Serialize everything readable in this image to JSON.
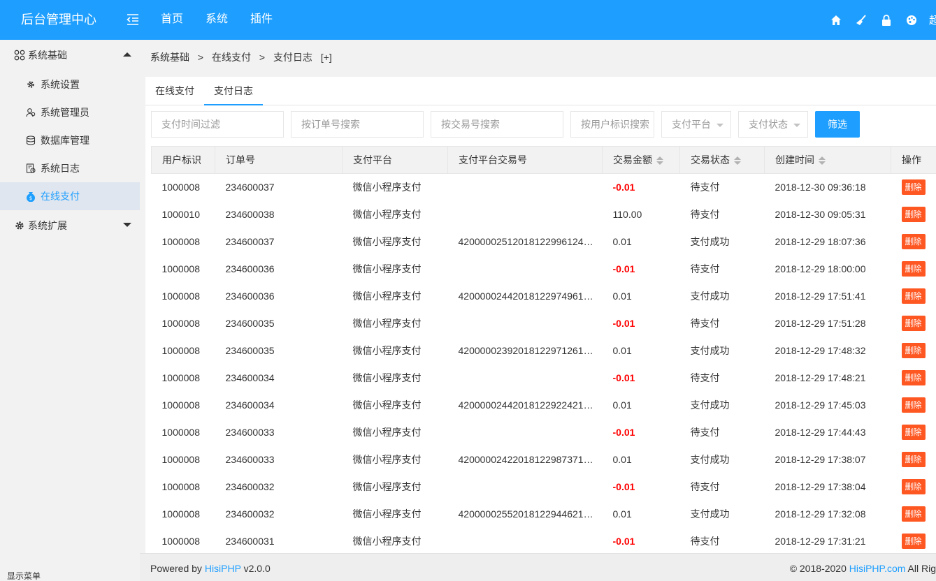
{
  "header": {
    "logo": "后台管理中心",
    "nav": [
      "首页",
      "系统",
      "插件"
    ],
    "user_partial": "超"
  },
  "sidebar": {
    "groups": [
      {
        "label": "系统基础",
        "icon": "apps-icon",
        "expanded": true,
        "items": [
          {
            "label": "系统设置",
            "icon": "gear-icon",
            "active": false
          },
          {
            "label": "系统管理员",
            "icon": "users-icon",
            "active": false
          },
          {
            "label": "数据库管理",
            "icon": "database-icon",
            "active": false
          },
          {
            "label": "系统日志",
            "icon": "log-icon",
            "active": false
          },
          {
            "label": "在线支付",
            "icon": "money-bag-icon",
            "active": true
          }
        ]
      },
      {
        "label": "系统扩展",
        "icon": "gear-icon",
        "expanded": false
      }
    ],
    "footer": "显示菜单"
  },
  "breadcrumb": [
    "系统基础",
    ">",
    "在线支付",
    ">",
    "支付日志",
    "[+]"
  ],
  "tabs": [
    {
      "label": "在线支付",
      "active": false
    },
    {
      "label": "支付日志",
      "active": true
    }
  ],
  "filters": {
    "time": "支付时间过滤",
    "order": "按订单号搜索",
    "trade": "按交易号搜索",
    "user": "按用户标识搜索",
    "platform": "支付平台",
    "status": "支付状态",
    "submit": "筛选"
  },
  "table": {
    "columns": [
      "用户标识",
      "订单号",
      "支付平台",
      "支付平台交易号",
      "交易金额",
      "交易状态",
      "创建时间",
      "操作"
    ],
    "rows": [
      {
        "user": "1000008",
        "order": "234600037",
        "platform": "微信小程序支付",
        "trade": "",
        "amount": "-0.01",
        "neg": true,
        "status": "待支付",
        "time": "2018-12-30 09:36:18"
      },
      {
        "user": "1000010",
        "order": "234600038",
        "platform": "微信小程序支付",
        "trade": "",
        "amount": "110.00",
        "neg": false,
        "status": "待支付",
        "time": "2018-12-30 09:05:31"
      },
      {
        "user": "1000008",
        "order": "234600037",
        "platform": "微信小程序支付",
        "trade": "42000002512018122996124…",
        "amount": "0.01",
        "neg": false,
        "status": "支付成功",
        "time": "2018-12-29 18:07:36"
      },
      {
        "user": "1000008",
        "order": "234600036",
        "platform": "微信小程序支付",
        "trade": "",
        "amount": "-0.01",
        "neg": true,
        "status": "待支付",
        "time": "2018-12-29 18:00:00"
      },
      {
        "user": "1000008",
        "order": "234600036",
        "platform": "微信小程序支付",
        "trade": "42000002442018122974961…",
        "amount": "0.01",
        "neg": false,
        "status": "支付成功",
        "time": "2018-12-29 17:51:41"
      },
      {
        "user": "1000008",
        "order": "234600035",
        "platform": "微信小程序支付",
        "trade": "",
        "amount": "-0.01",
        "neg": true,
        "status": "待支付",
        "time": "2018-12-29 17:51:28"
      },
      {
        "user": "1000008",
        "order": "234600035",
        "platform": "微信小程序支付",
        "trade": "42000002392018122971261…",
        "amount": "0.01",
        "neg": false,
        "status": "支付成功",
        "time": "2018-12-29 17:48:32"
      },
      {
        "user": "1000008",
        "order": "234600034",
        "platform": "微信小程序支付",
        "trade": "",
        "amount": "-0.01",
        "neg": true,
        "status": "待支付",
        "time": "2018-12-29 17:48:21"
      },
      {
        "user": "1000008",
        "order": "234600034",
        "platform": "微信小程序支付",
        "trade": "42000002442018122922421…",
        "amount": "0.01",
        "neg": false,
        "status": "支付成功",
        "time": "2018-12-29 17:45:03"
      },
      {
        "user": "1000008",
        "order": "234600033",
        "platform": "微信小程序支付",
        "trade": "",
        "amount": "-0.01",
        "neg": true,
        "status": "待支付",
        "time": "2018-12-29 17:44:43"
      },
      {
        "user": "1000008",
        "order": "234600033",
        "platform": "微信小程序支付",
        "trade": "42000002422018122987371…",
        "amount": "0.01",
        "neg": false,
        "status": "支付成功",
        "time": "2018-12-29 17:38:07"
      },
      {
        "user": "1000008",
        "order": "234600032",
        "platform": "微信小程序支付",
        "trade": "",
        "amount": "-0.01",
        "neg": true,
        "status": "待支付",
        "time": "2018-12-29 17:38:04"
      },
      {
        "user": "1000008",
        "order": "234600032",
        "platform": "微信小程序支付",
        "trade": "42000002552018122944621…",
        "amount": "0.01",
        "neg": false,
        "status": "支付成功",
        "time": "2018-12-29 17:32:08"
      },
      {
        "user": "1000008",
        "order": "234600031",
        "platform": "微信小程序支付",
        "trade": "",
        "amount": "-0.01",
        "neg": true,
        "status": "待支付",
        "time": "2018-12-29 17:31:21"
      }
    ],
    "action_label": "删除"
  },
  "footer": {
    "powered_prefix": "Powered by ",
    "powered_link": "HisiPHP",
    "version": " v2.0.0",
    "copy_prefix": "© 2018-2020 ",
    "copy_link": "HisiPHP.com",
    "copy_suffix": " All Rig"
  },
  "colors": {
    "primary": "#1e9fff",
    "danger": "#ff5722",
    "negative": "#ff0000"
  }
}
